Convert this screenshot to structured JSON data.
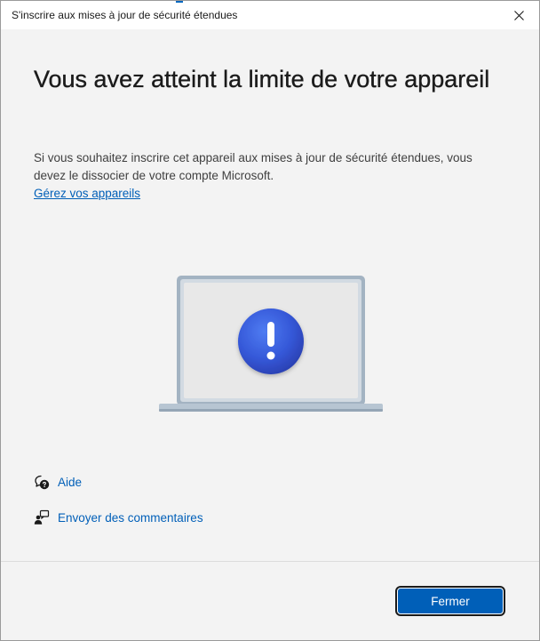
{
  "window": {
    "title": "S'inscrire aux mises à jour de sécurité étendues",
    "accent_color": "#0067c0"
  },
  "main": {
    "heading": "Vous avez atteint la limite de votre appareil",
    "description": "Si vous souhaitez inscrire cet appareil aux mises à jour de sécurité étendues, vous devez le dissocier de votre compte Microsoft.",
    "manage_link": "Gérez vos appareils",
    "illustration": {
      "icon": "laptop-with-exclamation-icon",
      "badge_color": "#3558d8"
    }
  },
  "links": {
    "help": {
      "label": "Aide",
      "icon": "help-chat-icon"
    },
    "feedback": {
      "label": "Envoyer des commentaires",
      "icon": "feedback-person-icon"
    }
  },
  "footer": {
    "close_label": "Fermer",
    "button_color": "#005fb8"
  }
}
